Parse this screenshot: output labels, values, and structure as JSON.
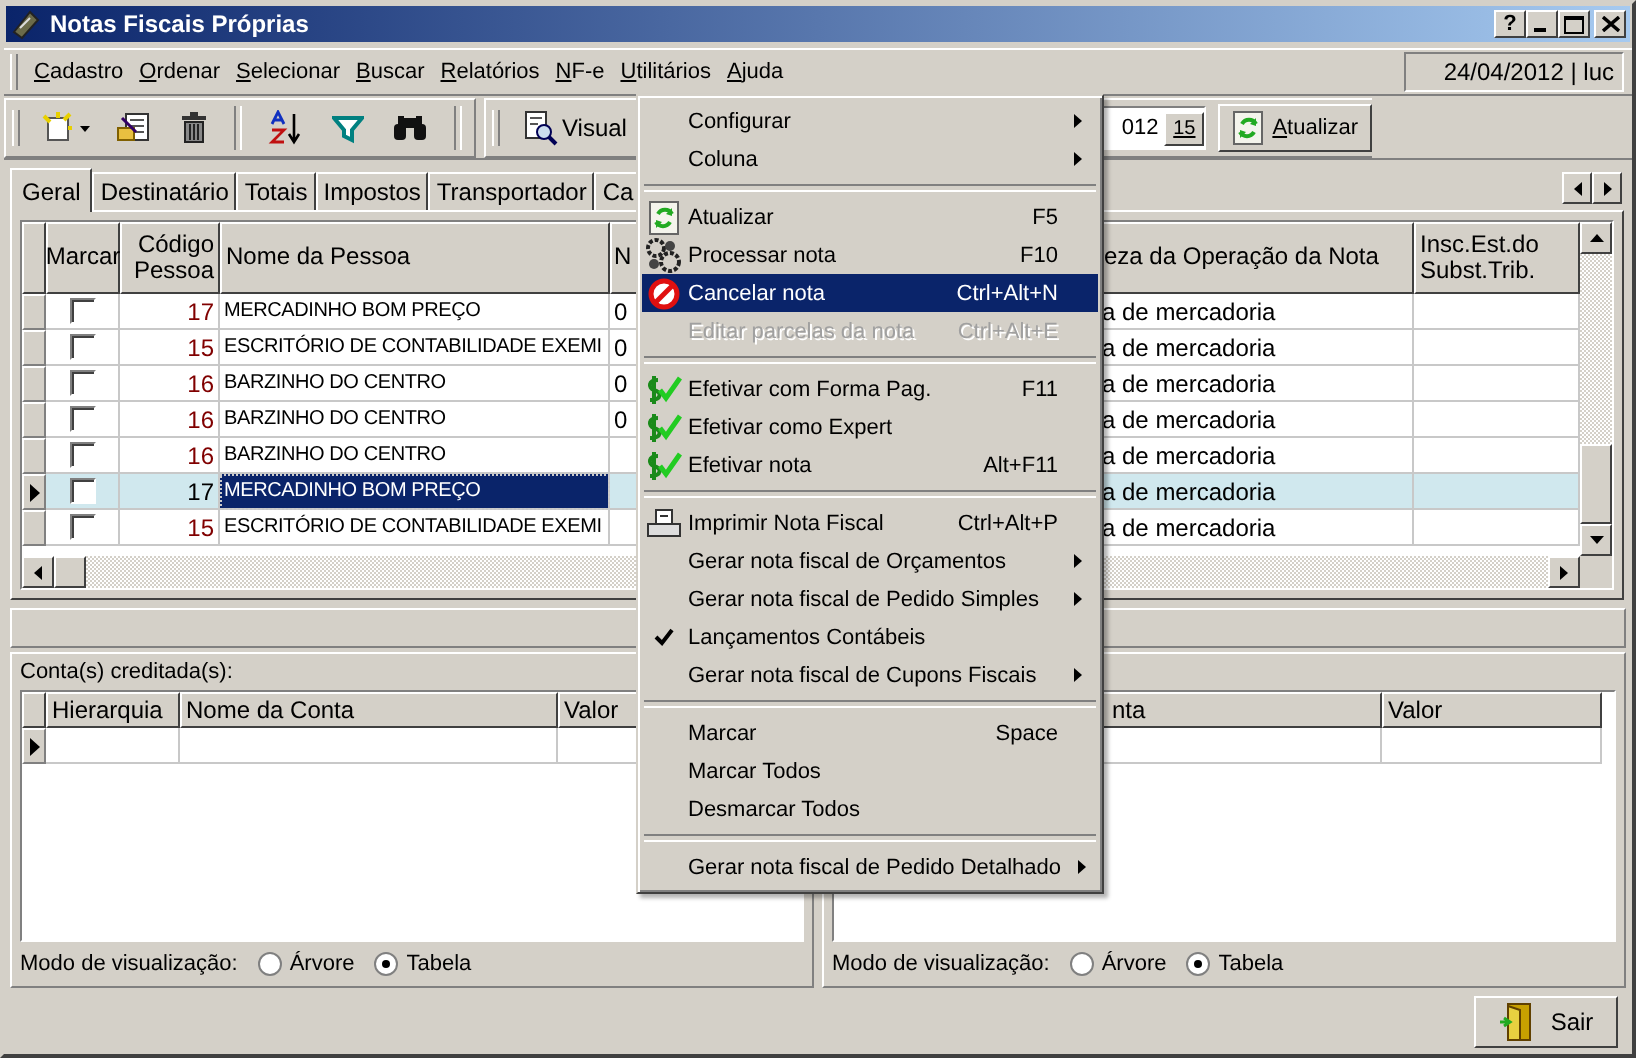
{
  "window": {
    "title": "Notas Fiscais Próprias",
    "help": "?"
  },
  "menubar": [
    {
      "label": "Cadastro"
    },
    {
      "label": "Ordenar"
    },
    {
      "label": "Selecionar"
    },
    {
      "label": "Buscar"
    },
    {
      "label": "Relatórios"
    },
    {
      "label": "NF-e"
    },
    {
      "label": "Utilitários"
    },
    {
      "label": "Ajuda"
    }
  ],
  "status": "24/04/2012 | luc",
  "toolbar": {
    "view_button": "Visual",
    "date_value": "012",
    "calendar_label": "15",
    "refresh_button": "Atualizar"
  },
  "tabs": [
    {
      "label": "Geral",
      "selected": true
    },
    {
      "label": "Destinatário",
      "selected": false
    },
    {
      "label": "Totais",
      "selected": false
    },
    {
      "label": "Impostos",
      "selected": false
    },
    {
      "label": "Transportador",
      "selected": false
    },
    {
      "label": "Ca",
      "selected": false
    }
  ],
  "grid": {
    "columns": [
      "Marcar",
      "Código Pessoa",
      "Nome da Pessoa",
      "N",
      "eza da Operação da Nota",
      "Insc.Est.do Subst.Trib."
    ],
    "rows": [
      {
        "marked": false,
        "code": "17",
        "name": "MERCADINHO BOM PREÇO",
        "column_4": "0",
        "nature": "a de mercadoria",
        "selected": false
      },
      {
        "marked": false,
        "code": "15",
        "name": "ESCRITÓRIO DE CONTABILIDADE EXEMI",
        "column_4": "0",
        "nature": "a de mercadoria",
        "selected": false
      },
      {
        "marked": false,
        "code": "16",
        "name": "BARZINHO DO CENTRO",
        "column_4": "0",
        "nature": "a de mercadoria",
        "selected": false
      },
      {
        "marked": false,
        "code": "16",
        "name": "BARZINHO DO CENTRO",
        "column_4": "0",
        "nature": "a de mercadoria",
        "selected": false
      },
      {
        "marked": false,
        "code": "16",
        "name": "BARZINHO DO CENTRO",
        "nature": "a de mercadoria",
        "selected": false
      },
      {
        "marked": false,
        "code": "17",
        "name": "MERCADINHO BOM PREÇO",
        "nature": "a de mercadoria",
        "selected": true
      },
      {
        "marked": false,
        "code": "15",
        "name": "ESCRITÓRIO DE CONTABILIDADE EXEMI",
        "nature": "a de mercadoria",
        "selected": false
      }
    ]
  },
  "credit_pane": {
    "title": "Conta(s) creditada(s):",
    "columns": [
      "Hierarquia",
      "Nome da Conta",
      "Valor"
    ],
    "view_label": "Modo de visualização:",
    "view_options": [
      {
        "label": "Árvore",
        "selected": false
      },
      {
        "label": "Tabela",
        "selected": true
      }
    ]
  },
  "debit_pane": {
    "columns": [
      "nta",
      "Valor"
    ],
    "view_label": "Modo de visualização:",
    "view_options": [
      {
        "label": "Árvore",
        "selected": false
      },
      {
        "label": "Tabela",
        "selected": true
      }
    ]
  },
  "exit_button": "Sair",
  "context_menu": {
    "groups": [
      [
        {
          "label": "Configurar",
          "submenu": true,
          "selected": false,
          "disabled": false,
          "checked": false
        },
        {
          "label": "Coluna",
          "submenu": true,
          "selected": false,
          "disabled": false,
          "checked": false
        }
      ],
      [
        {
          "label": "Atualizar",
          "shortcut": "F5",
          "submenu": false,
          "selected": false,
          "disabled": false,
          "checked": false
        },
        {
          "label": "Processar nota",
          "shortcut": "F10",
          "submenu": false,
          "selected": false,
          "disabled": false,
          "checked": false
        },
        {
          "label": "Cancelar nota",
          "shortcut": "Ctrl+Alt+N",
          "submenu": false,
          "selected": true,
          "disabled": false,
          "checked": false
        },
        {
          "label": "Editar parcelas da nota",
          "shortcut": "Ctrl+Alt+E",
          "submenu": false,
          "selected": false,
          "disabled": true,
          "checked": false
        }
      ],
      [
        {
          "label": "Efetivar com Forma Pag.",
          "shortcut": "F11",
          "submenu": false,
          "selected": false,
          "disabled": false,
          "checked": false
        },
        {
          "label": "Efetivar como Expert",
          "submenu": false,
          "selected": false,
          "disabled": false,
          "checked": false
        },
        {
          "label": "Efetivar nota",
          "shortcut": "Alt+F11",
          "submenu": false,
          "selected": false,
          "disabled": false,
          "checked": false
        }
      ],
      [
        {
          "label": "Imprimir Nota Fiscal",
          "shortcut": "Ctrl+Alt+P",
          "submenu": false,
          "selected": false,
          "disabled": false,
          "checked": false
        },
        {
          "label": "Gerar nota fiscal de Orçamentos",
          "submenu": true,
          "selected": false,
          "disabled": false,
          "checked": false
        },
        {
          "label": "Gerar nota fiscal de Pedido Simples",
          "submenu": true,
          "selected": false,
          "disabled": false,
          "checked": false
        },
        {
          "label": "Lançamentos Contábeis",
          "submenu": false,
          "selected": false,
          "disabled": false,
          "checked": true
        },
        {
          "label": "Gerar nota fiscal de Cupons Fiscais",
          "submenu": true,
          "selected": false,
          "disabled": false,
          "checked": false
        }
      ],
      [
        {
          "label": "Marcar",
          "shortcut": "Space",
          "submenu": false,
          "selected": false,
          "disabled": false,
          "checked": false
        },
        {
          "label": "Marcar Todos",
          "submenu": false,
          "selected": false,
          "disabled": false,
          "checked": false
        },
        {
          "label": "Desmarcar Todos",
          "submenu": false,
          "selected": false,
          "disabled": false,
          "checked": false
        }
      ],
      [
        {
          "label": "Gerar nota fiscal de Pedido Detalhado",
          "submenu": true,
          "selected": false,
          "disabled": false,
          "checked": false
        }
      ]
    ]
  }
}
